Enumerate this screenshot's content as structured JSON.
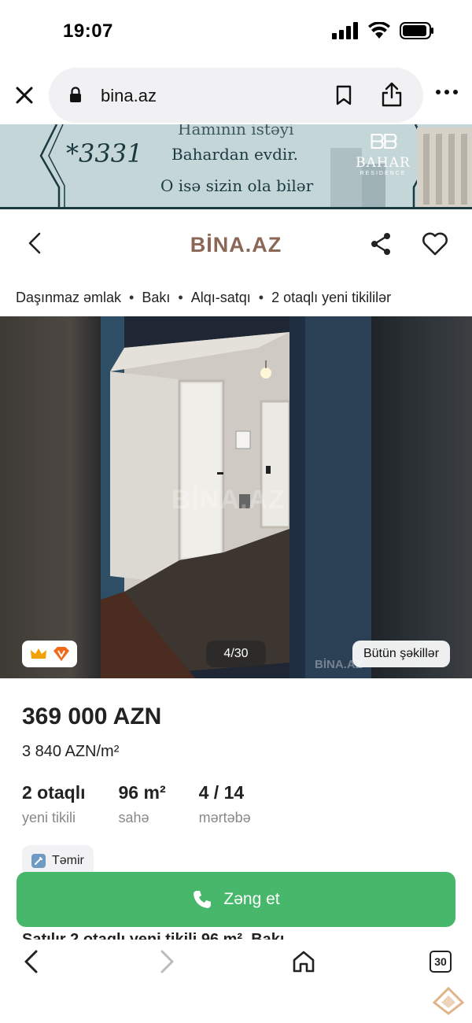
{
  "status_bar": {
    "time": "19:07"
  },
  "browser": {
    "url": "bina.az",
    "tabs_count": "30"
  },
  "banner": {
    "code": "*3331",
    "line1": "Hamının istəyi",
    "line2": "Bahardan evdir.",
    "line3": "O isə sizin ola bilər",
    "brand": "BAHAR",
    "brand_sub": "RESIDENCE"
  },
  "site": {
    "logo": "BİNA.AZ"
  },
  "breadcrumb": [
    "Daşınmaz əmlak",
    "Bakı",
    "Alqı-satqı",
    "2 otaqlı yeni tikililər"
  ],
  "photo": {
    "watermark": "BİNA.AZ",
    "counter": "4/30",
    "all_photos_label": "Bütün şəkillər"
  },
  "listing": {
    "price": "369 000 AZN",
    "price_per_m2": "3 840 AZN/m²",
    "facts": [
      {
        "value": "2 otaqlı",
        "label": "yeni tikili"
      },
      {
        "value": "96 m²",
        "label": "sahə"
      },
      {
        "value": "4 / 14",
        "label": "mərtəbə"
      }
    ],
    "tag": "Təmir",
    "title_partial": "Satılır 2 otaqlı yeni tikili 96 m², Bakı"
  },
  "actions": {
    "call_label": "Zəng et"
  },
  "colors": {
    "accent_green": "#47b86b",
    "logo_brown": "#8a6757",
    "banner_bg": "#c5d6d9"
  }
}
